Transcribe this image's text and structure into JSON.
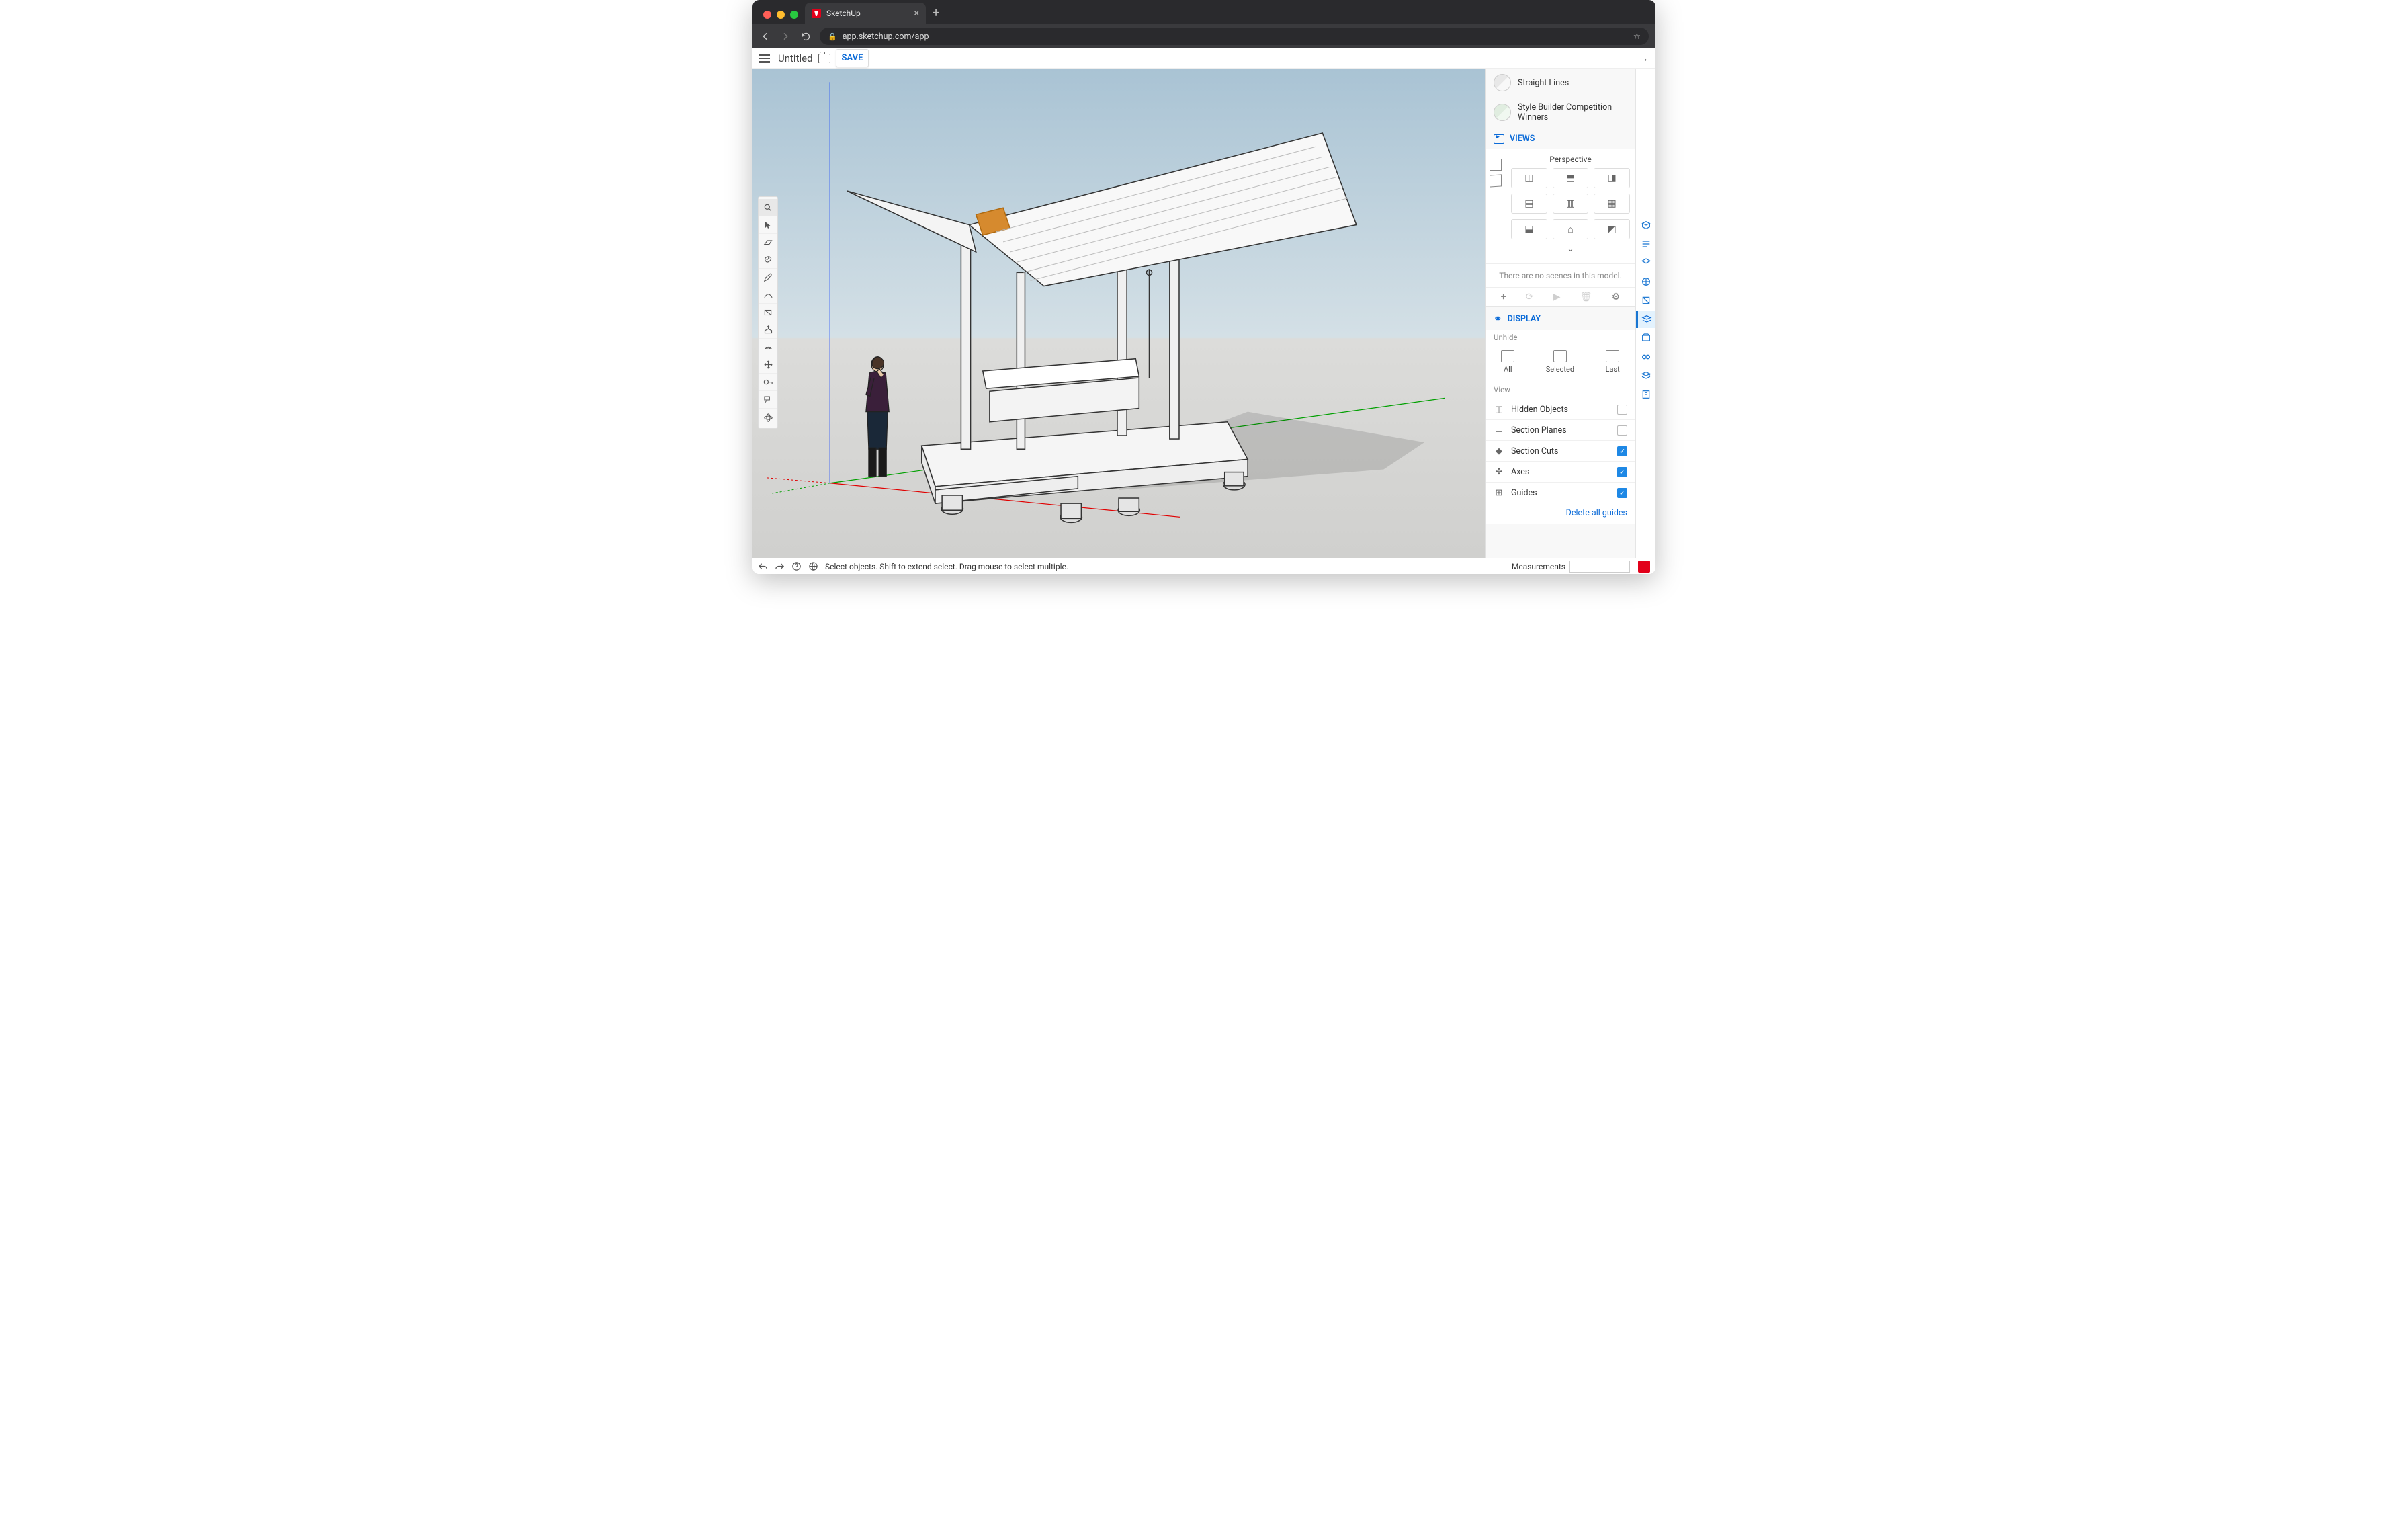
{
  "browser": {
    "tab_title": "SketchUp",
    "url": "app.sketchup.com/app"
  },
  "header": {
    "doc_title": "Untitled",
    "save_label": "SAVE"
  },
  "styles": {
    "items": [
      "Straight Lines",
      "Style Builder Competition Winners"
    ]
  },
  "views": {
    "title": "VIEWS",
    "mode_label": "Perspective",
    "no_scenes_msg": "There are no scenes in this model."
  },
  "display": {
    "title": "DISPLAY",
    "unhide_label": "Unhide",
    "unhide_items": [
      "All",
      "Selected",
      "Last"
    ],
    "view_label": "View",
    "options": [
      {
        "label": "Hidden Objects",
        "checked": false
      },
      {
        "label": "Section Planes",
        "checked": false
      },
      {
        "label": "Section Cuts",
        "checked": true
      },
      {
        "label": "Axes",
        "checked": true
      },
      {
        "label": "Guides",
        "checked": true
      }
    ],
    "delete_guides": "Delete all guides"
  },
  "status": {
    "hint": "Select objects. Shift to extend select. Drag mouse to select multiple.",
    "measurements_label": "Measurements"
  }
}
